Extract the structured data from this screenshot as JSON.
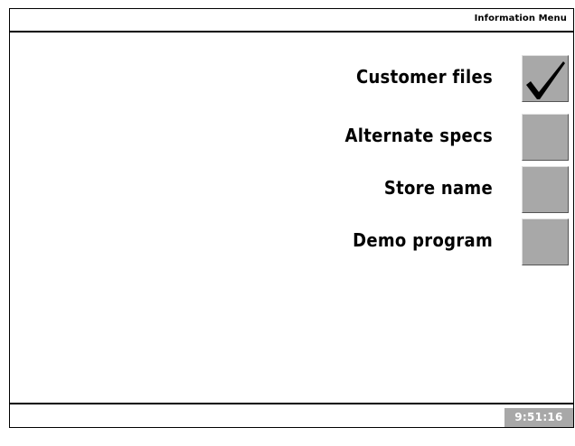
{
  "title_bar": {
    "title": "Information Menu"
  },
  "options": [
    {
      "label": "Customer files",
      "checked": true
    },
    {
      "label": "Alternate specs",
      "checked": false
    },
    {
      "label": "Store name",
      "checked": false
    },
    {
      "label": "Demo program",
      "checked": false
    }
  ],
  "status_bar": {
    "time": "9:51:16 AM"
  },
  "colors": {
    "checkbox_fill": "#a8a8a8",
    "background": "#ffffff",
    "text": "#000000",
    "clock_text": "#ffffff"
  },
  "icons": {
    "check": "checkmark-icon"
  }
}
